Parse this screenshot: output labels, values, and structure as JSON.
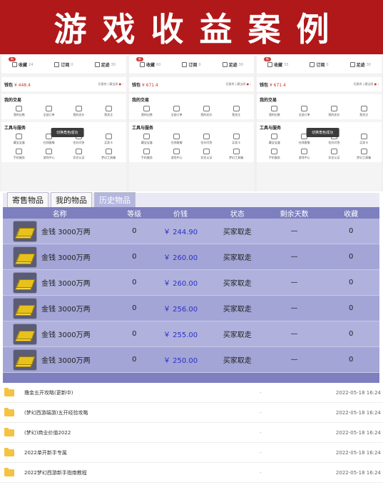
{
  "banner": {
    "title": "游戏收益案例"
  },
  "panels": [
    {
      "badge": "新",
      "top": [
        {
          "label": "收藏",
          "count": "24"
        },
        {
          "label": "订阅",
          "count": "0"
        },
        {
          "label": "足迹",
          "count": "30"
        }
      ],
      "wallet_label": "钱包",
      "wallet_amount": "¥ 448.4",
      "wallet_right": "优惠券 | 藏宝阁",
      "section1_title": "我的交易",
      "section1_items": [
        "我的出售",
        "全部订单",
        "我的还价",
        "我关注"
      ],
      "section2_title": "工具与服务",
      "section2_items": [
        "藏宝宝盒",
        "在线客服",
        "估价问答",
        "买卖卡"
      ],
      "section3_items": [
        "手机服务",
        "游戏中心",
        "实名认证",
        "梦幻工具箱"
      ],
      "tooltip": "切换角色成功"
    },
    {
      "badge": "新",
      "top": [
        {
          "label": "收藏",
          "count": "60"
        },
        {
          "label": "订阅",
          "count": "0"
        },
        {
          "label": "足迹",
          "count": "30"
        }
      ],
      "wallet_label": "钱包",
      "wallet_amount": "¥ 671.4",
      "wallet_right": "优惠券 | 藏宝阁",
      "section1_title": "我的交易",
      "section1_items": [
        "我的出售",
        "全部订单",
        "我的还价",
        "我关注"
      ],
      "section2_title": "工具与服务",
      "section2_items": [
        "藏宝宝盒",
        "在线客服",
        "估价问答",
        "买卖卡"
      ],
      "section3_items": [
        "手机服务",
        "游戏中心",
        "实名认证",
        "梦幻工具箱"
      ],
      "tooltip": ""
    },
    {
      "badge": "新",
      "top": [
        {
          "label": "收藏",
          "count": "33"
        },
        {
          "label": "订阅",
          "count": "0"
        },
        {
          "label": "足迹",
          "count": "30"
        }
      ],
      "wallet_label": "钱包",
      "wallet_amount": "¥ 671.4",
      "wallet_right": "优惠券 | 藏宝阁",
      "section1_title": "我的交易",
      "section1_items": [
        "我的出售",
        "全部订单",
        "我的还价",
        "我关注"
      ],
      "section2_title": "工具与服务",
      "section2_items": [
        "藏宝宝盒",
        "在线客服",
        "估价问答",
        "买卖卡"
      ],
      "section3_items": [
        "手机服务",
        "游戏中心",
        "实名认证",
        "梦幻工具箱"
      ],
      "tooltip": "切换角色成功"
    }
  ],
  "trade": {
    "tabs": [
      "寄售物品",
      "我的物品",
      "历史物品"
    ],
    "active_tab": 2,
    "headers": [
      "名称",
      "等级",
      "价钱",
      "状态",
      "剩余天数",
      "收藏"
    ],
    "rows": [
      {
        "name": "金钱 3000万两",
        "level": "0",
        "price": "￥ 244.90",
        "status": "买家取走",
        "days": "—",
        "fav": "0"
      },
      {
        "name": "金钱 3000万两",
        "level": "0",
        "price": "￥ 260.00",
        "status": "买家取走",
        "days": "—",
        "fav": "0"
      },
      {
        "name": "金钱 3000万两",
        "level": "0",
        "price": "￥ 260.00",
        "status": "买家取走",
        "days": "—",
        "fav": "0"
      },
      {
        "name": "金钱 3000万两",
        "level": "0",
        "price": "￥ 256.00",
        "status": "买家取走",
        "days": "—",
        "fav": "0"
      },
      {
        "name": "金钱 3000万两",
        "level": "0",
        "price": "￥ 255.00",
        "status": "买家取走",
        "days": "—",
        "fav": "0"
      },
      {
        "name": "金钱 3000万两",
        "level": "0",
        "price": "￥ 250.00",
        "status": "买家取走",
        "days": "—",
        "fav": "0"
      }
    ]
  },
  "files": [
    {
      "name": "撸金五开攻略(更新中)",
      "dash": "-",
      "date": "2022-05-18 16:24"
    },
    {
      "name": "(梦幻西游端游)五开经验攻略",
      "dash": "-",
      "date": "2022-05-18 16:24"
    },
    {
      "name": "(梦幻)商业价值2022",
      "dash": "-",
      "date": "2022-05-18 16:24"
    },
    {
      "name": "2022单开新手专属",
      "dash": "-",
      "date": "2022-05-18 16:24"
    },
    {
      "name": "2022梦幻西游新手指南教程",
      "dash": "-",
      "date": "2022-05-18 16:24"
    }
  ]
}
